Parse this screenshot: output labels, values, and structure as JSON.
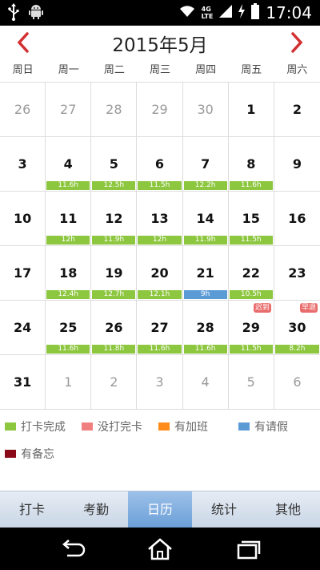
{
  "statusbar": {
    "time": "17:04",
    "network_top": "4G",
    "network_bottom": "LTE",
    "icons": [
      "usb-icon",
      "android-icon",
      "wifi-icon",
      "cell-signal-icon",
      "charging-icon",
      "battery-icon"
    ]
  },
  "header": {
    "title": "2015年5月"
  },
  "weekdays": [
    "周日",
    "周一",
    "周二",
    "周三",
    "周四",
    "周五",
    "周六"
  ],
  "calendar": {
    "days": [
      {
        "n": "26",
        "other": true
      },
      {
        "n": "27",
        "other": true
      },
      {
        "n": "28",
        "other": true
      },
      {
        "n": "29",
        "other": true
      },
      {
        "n": "30",
        "other": true
      },
      {
        "n": "1"
      },
      {
        "n": "2"
      },
      {
        "n": "3"
      },
      {
        "n": "4",
        "hours": "11.6h",
        "status": "green"
      },
      {
        "n": "5",
        "hours": "12.5h",
        "status": "green"
      },
      {
        "n": "6",
        "hours": "11.5h",
        "status": "green"
      },
      {
        "n": "7",
        "hours": "12.2h",
        "status": "green"
      },
      {
        "n": "8",
        "hours": "11.6h",
        "status": "green"
      },
      {
        "n": "9"
      },
      {
        "n": "10"
      },
      {
        "n": "11",
        "hours": "12h",
        "status": "green"
      },
      {
        "n": "12",
        "hours": "11.9h",
        "status": "green"
      },
      {
        "n": "13",
        "hours": "12h",
        "status": "green"
      },
      {
        "n": "14",
        "hours": "11.9h",
        "status": "green"
      },
      {
        "n": "15",
        "hours": "11.5h",
        "status": "green"
      },
      {
        "n": "16"
      },
      {
        "n": "17"
      },
      {
        "n": "18",
        "hours": "12.4h",
        "status": "green"
      },
      {
        "n": "19",
        "hours": "12.7h",
        "status": "green"
      },
      {
        "n": "20",
        "hours": "12.1h",
        "status": "green"
      },
      {
        "n": "21",
        "hours": "9h",
        "status": "blue"
      },
      {
        "n": "22",
        "hours": "10.5h",
        "status": "green"
      },
      {
        "n": "23"
      },
      {
        "n": "24"
      },
      {
        "n": "25",
        "hours": "11.6h",
        "status": "green"
      },
      {
        "n": "26",
        "hours": "11.8h",
        "status": "green"
      },
      {
        "n": "27",
        "hours": "11.6h",
        "status": "green"
      },
      {
        "n": "28",
        "hours": "11.6h",
        "status": "green"
      },
      {
        "n": "29",
        "hours": "11.5h",
        "status": "green",
        "badge": "迟到"
      },
      {
        "n": "30",
        "hours": "8.2h",
        "status": "green",
        "badge": "早退"
      },
      {
        "n": "31"
      },
      {
        "n": "1",
        "other": true
      },
      {
        "n": "2",
        "other": true
      },
      {
        "n": "3",
        "other": true
      },
      {
        "n": "4",
        "other": true
      },
      {
        "n": "5",
        "other": true
      },
      {
        "n": "6",
        "other": true
      }
    ]
  },
  "legend": [
    {
      "label": "打卡完成",
      "color": "#8dc63f"
    },
    {
      "label": "没打完卡",
      "color": "#f08080"
    },
    {
      "label": "有加班",
      "color": "#ff8c1a"
    },
    {
      "label": "有请假",
      "color": "#5b9bd5"
    },
    {
      "label": "有备忘",
      "color": "#8b0a1a"
    }
  ],
  "tabs": [
    {
      "label": "打卡",
      "active": false
    },
    {
      "label": "考勤",
      "active": false
    },
    {
      "label": "日历",
      "active": true
    },
    {
      "label": "统计",
      "active": false
    },
    {
      "label": "其他",
      "active": false
    }
  ],
  "colors": {
    "accent": "#d32f2f",
    "done": "#8dc63f",
    "leave": "#5b9bd5",
    "badge": "#ea6b6b"
  }
}
